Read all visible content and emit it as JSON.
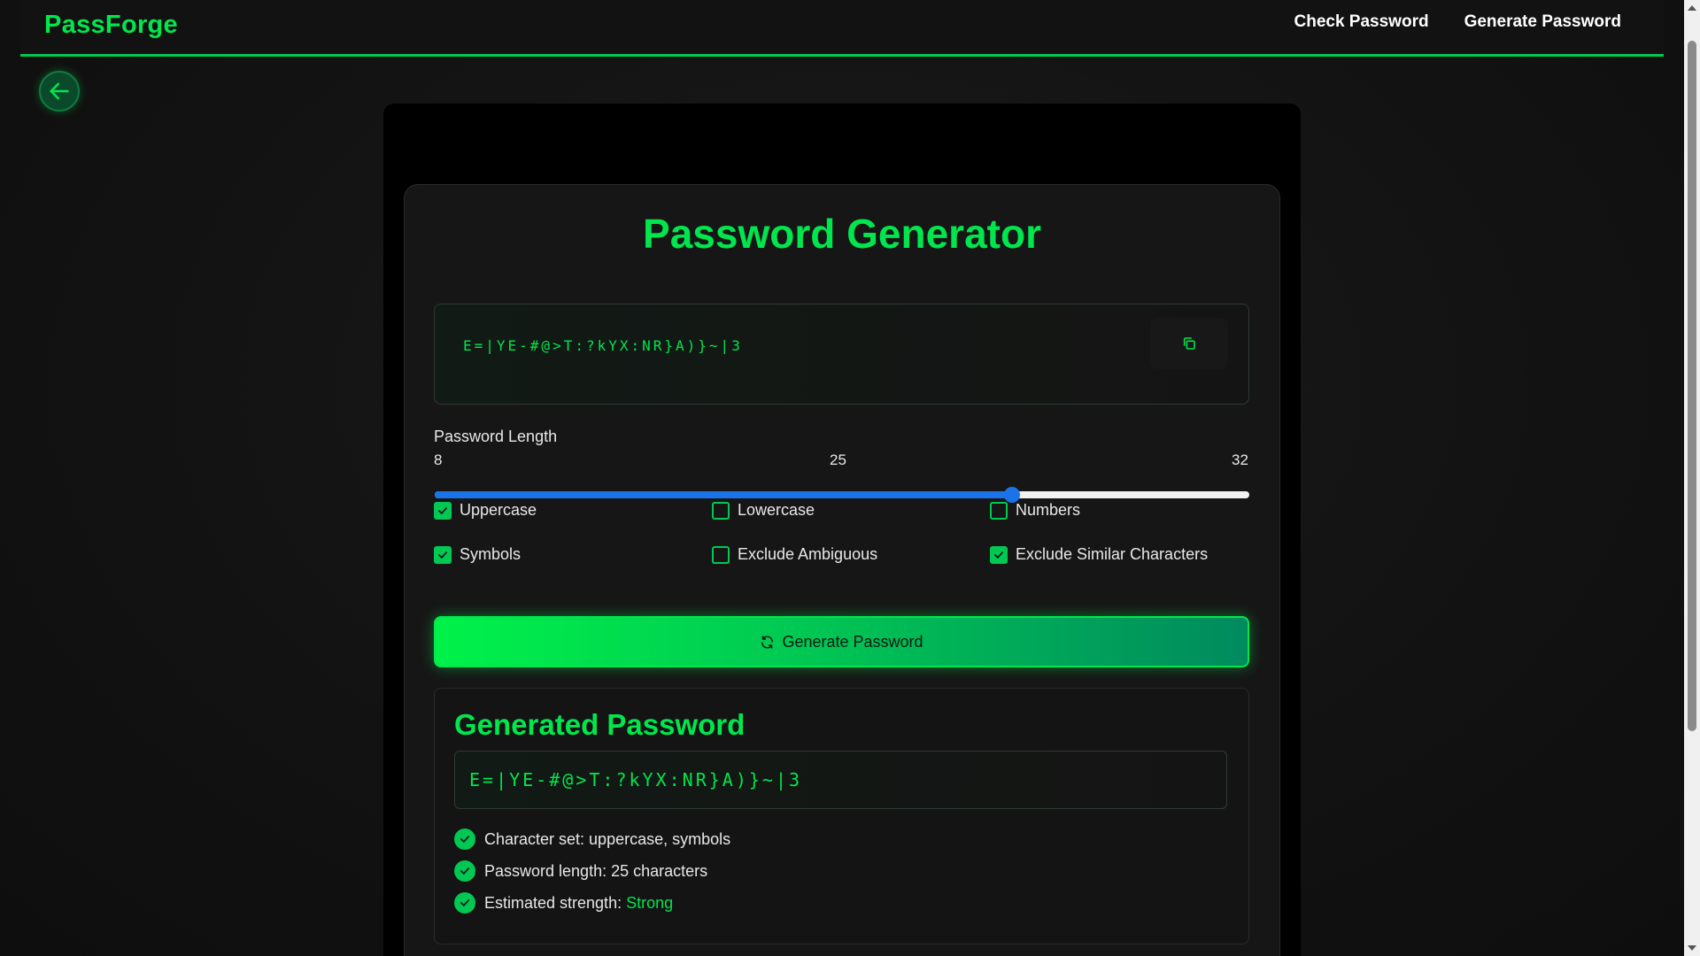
{
  "nav": {
    "brand": "PassForge",
    "links": [
      {
        "label": "Check Password"
      },
      {
        "label": "Generate Password"
      }
    ]
  },
  "generator": {
    "title": "Password Generator",
    "password": "E=|YE-#@>T:?kYX:NR}A)}~|3",
    "length": {
      "label": "Password Length",
      "min": "8",
      "current": "25",
      "max": "32",
      "value": 25,
      "min_value": 8,
      "max_value": 32
    },
    "options": [
      {
        "label": "Uppercase",
        "checked": true
      },
      {
        "label": "Lowercase",
        "checked": false
      },
      {
        "label": "Numbers",
        "checked": false
      },
      {
        "label": "Symbols",
        "checked": true
      },
      {
        "label": "Exclude Ambiguous",
        "checked": false
      },
      {
        "label": "Exclude Similar Characters",
        "checked": true
      }
    ],
    "generate_label": "Generate Password"
  },
  "result": {
    "title": "Generated Password",
    "password": "E=|YE-#@>T:?kYX:NR}A)}~|3",
    "info": [
      {
        "text": "Character set: uppercase, symbols"
      },
      {
        "text": "Password length: 25 characters"
      },
      {
        "text": "Estimated strength: ",
        "highlight": "Strong"
      }
    ]
  },
  "colors": {
    "accent": "#00e64d",
    "slider": "#1a73e8",
    "background": "#121212"
  },
  "icons": {
    "back": "arrow-left-icon",
    "copy": "copy-icon",
    "refresh": "refresh-icon",
    "check": "check-icon"
  }
}
